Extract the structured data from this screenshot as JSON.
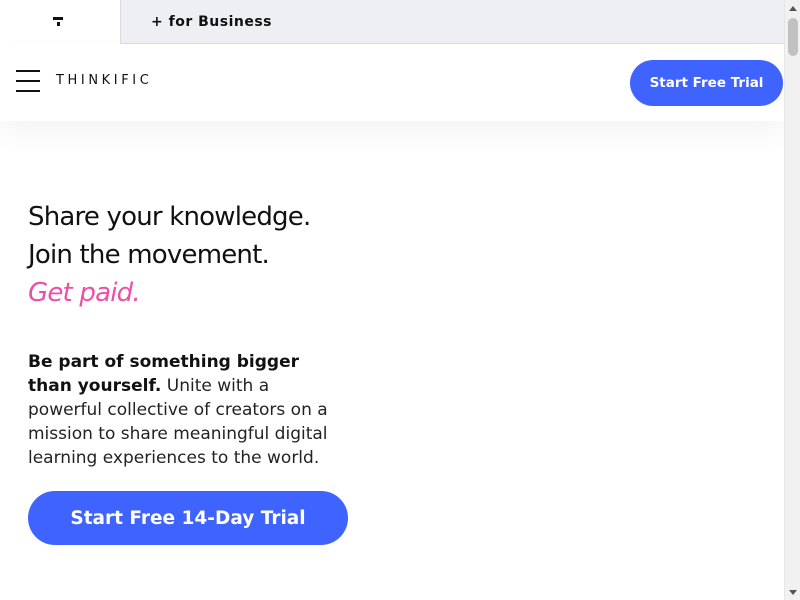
{
  "tabbar": {
    "logo_icon": "thinkific-t-mark-icon",
    "business_tab_label": "+ for Business"
  },
  "header": {
    "menu_icon": "hamburger-menu-icon",
    "brand": "THINKIFIC",
    "cta_label": "Start Free Trial"
  },
  "hero": {
    "headline_line1": "Share your knowledge.",
    "headline_line2": "Join the movement.",
    "headline_line3": "Get paid.",
    "desc_bold": "Be part of something bigger than yourself.",
    "desc_rest": "Unite with a powerful collective of creators on a mission to share meaningful digital learning experiences to the world.",
    "cta_label": "Start Free 14-Day Trial"
  },
  "colors": {
    "accent_blue": "#3f63ff",
    "accent_pink": "#ec4fa5",
    "tabbar_bg": "#eeeff3"
  }
}
